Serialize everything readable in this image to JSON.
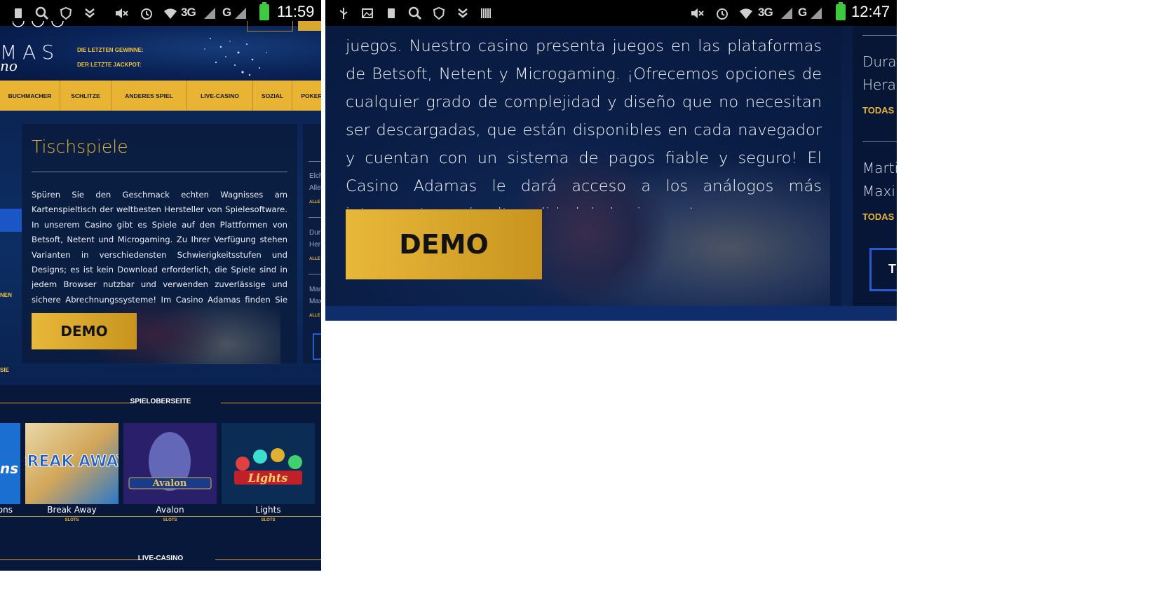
{
  "left": {
    "status": {
      "time": "11:59",
      "net1": "3G",
      "net2": "G",
      "icons": [
        "sim-icon",
        "search-icon",
        "shield-icon",
        "download-icon",
        "mute-icon",
        "alarm-icon",
        "wifi-icon",
        "signal-icon",
        "signal-icon",
        "battery-icon"
      ]
    },
    "header": {
      "logo": "MAS",
      "logo_sub": "no",
      "last_winners": "DIE LETZTEN GEWINNE:",
      "last_jackpot": "DER LETZTE JACKPOT:"
    },
    "nav": [
      "BUCHMACHER",
      "SCHLITZE",
      "ANDERES SPIEL",
      "LIVE-CASINO",
      "SOZIAL",
      "POKER"
    ],
    "card": {
      "title": "Tischspiele",
      "text": "Spüren Sie den Geschmack echten Wagnisses am Kartenspieltisch der weltbesten Hersteller von Spielesoftware. In unserem Casino gibt es Spiele auf den Plattformen von Betsoft, Netent und Microgaming. Zu Ihrer Verfügung stehen Varianten in verschiedensten Schwierigkeitsstufen und Designs; es ist kein Download erforderlich, die Spiele sind in jedem Browser nutzbar und verwenden zuverlässige und sichere Abrechnungssysteme! Im Casino Adamas finden Sie Zugang zu den interessantesten Analoga ihrer Art weltweit.",
      "demo": "DEMO"
    },
    "side": {
      "nen": "NEN",
      "sie": "SIE",
      "r1a": "Elch",
      "r1b": "Alle",
      "r1c": "ALLE",
      "r2a": "Dur",
      "r2b": "Her",
      "r2c": "ALLE",
      "r3a": "Mar",
      "r3b": "Max",
      "r3c": "ALLE"
    },
    "section1": "SPIELOBERSEITE",
    "section2": "LIVE-CASINO",
    "games": [
      {
        "name": "ons",
        "cat": ""
      },
      {
        "name": "Break Away",
        "cat": "SLOTS",
        "art": "BREAK AWAY"
      },
      {
        "name": "Avalon",
        "cat": "SLOTS",
        "art": "Avalon"
      },
      {
        "name": "Lights",
        "cat": "SLOTS",
        "art": "Lights"
      }
    ],
    "first_game_art": "ns"
  },
  "right": {
    "status": {
      "time": "12:47",
      "net1": "3G",
      "net2": "G",
      "icons": [
        "usb-icon",
        "image-icon",
        "sim-icon",
        "search-icon",
        "shield-icon",
        "download-icon",
        "barcode-icon",
        "mute-icon",
        "alarm-icon",
        "wifi-icon",
        "signal-icon",
        "signal-icon",
        "battery-charging-icon"
      ]
    },
    "text": "juegos. Nuestro casino presenta juegos en las plataformas de Betsoft, Netent y Microgaming. ¡Ofrecemos opciones de cualquier grado de complejidad y diseño que no necesitan ser descargadas, que están disponibles en cada navegador y cuentan con un sistema de pagos fiable y seguro! El Casino Adamas le dará acceso a los análogos más interesantes y de alta calidad de los juegos!",
    "demo": "DEMO",
    "side": {
      "n1": "Durar",
      "n1b": "Heras",
      "g1": "TODAS",
      "n2": "Martir",
      "n2b": "Maxi",
      "g2": "TODAS",
      "btn": "T"
    }
  },
  "colors": {
    "gold": "#e6b53c",
    "navy": "#0a1a3a",
    "nav_yellow": "#e9b333"
  }
}
